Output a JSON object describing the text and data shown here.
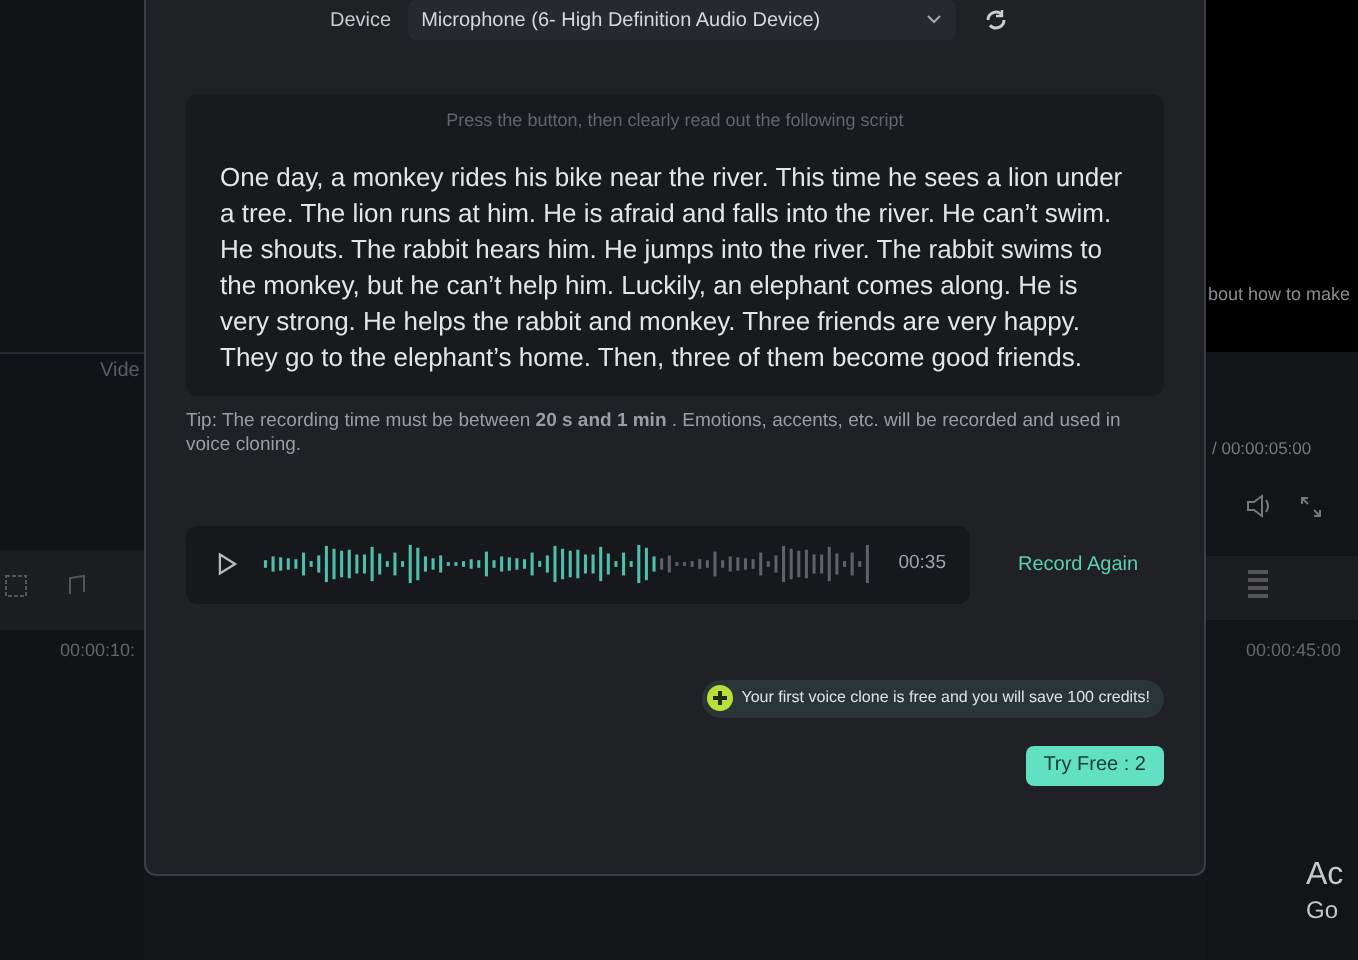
{
  "background_left": {
    "panel_label": "Vide",
    "timecode": "00:00:10:"
  },
  "background_right": {
    "caption": "bout how to make",
    "duration": "/ 00:00:05:00",
    "timecode": "00:00:45:00",
    "notice_title": "Ac",
    "notice_subtitle": "Go"
  },
  "dialog": {
    "device_label": "Device",
    "device_value": "Microphone (6- High Definition Audio Device)",
    "instruction": "Press the button, then clearly read out the following script",
    "script": "One day, a monkey rides his bike near the river. This time he sees a lion under a tree. The lion runs at him. He is afraid and falls into the river. He can’t swim. He shouts. The rabbit hears him. He jumps into the river. The rabbit swims to the monkey, but he can’t help him. Luckily, an elephant comes along. He is very strong. He helps the rabbit and monkey. Three friends are very happy. They go to the elephant’s home. Then, three of them become good friends.",
    "tip": "Tip: The recording time must be between **20 s and 1 min** . Emotions, accents, etc. will be recorded and used in voice cloning.",
    "recording": {
      "duration": "00:35"
    },
    "record_again": "Record Again",
    "promo": "Your first voice clone is free and you will save 100 credits!",
    "try_button": "Try Free : 2"
  }
}
